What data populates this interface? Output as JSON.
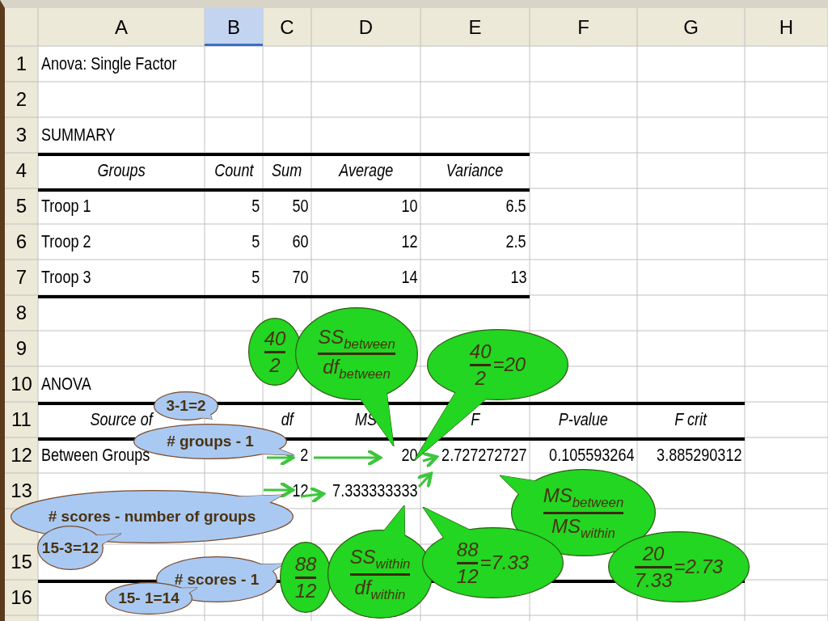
{
  "sheet": {
    "columns": [
      {
        "label": "A",
        "selected": false
      },
      {
        "label": "B",
        "selected": true
      },
      {
        "label": "C",
        "selected": false
      },
      {
        "label": "D",
        "selected": false
      },
      {
        "label": "E",
        "selected": false
      },
      {
        "label": "F",
        "selected": false
      },
      {
        "label": "G",
        "selected": false
      },
      {
        "label": "H",
        "selected": false
      }
    ],
    "rows": [
      {
        "number": "1",
        "kind": "title",
        "rule_above": false,
        "cells": [
          "Anova: Single Factor"
        ]
      },
      {
        "number": "2",
        "kind": "data",
        "rule_above": false,
        "cells": []
      },
      {
        "number": "3",
        "kind": "title",
        "rule_above": false,
        "cells": [
          "SUMMARY"
        ]
      },
      {
        "number": "4",
        "kind": "header",
        "rule_above": true,
        "cells": [
          "Groups",
          "Count",
          "Sum",
          "Average",
          "Variance"
        ]
      },
      {
        "number": "5",
        "kind": "data",
        "rule_above": true,
        "cells": [
          "Troop 1",
          "5",
          "50",
          "10",
          "6.5"
        ]
      },
      {
        "number": "6",
        "kind": "data",
        "rule_above": false,
        "cells": [
          "Troop 2",
          "5",
          "60",
          "12",
          "2.5"
        ]
      },
      {
        "number": "7",
        "kind": "data",
        "rule_above": false,
        "cells": [
          "Troop 3",
          "5",
          "70",
          "14",
          "13"
        ]
      },
      {
        "number": "8",
        "kind": "data",
        "rule_above": true,
        "cells": []
      },
      {
        "number": "9",
        "kind": "data",
        "rule_above": false,
        "cells": []
      },
      {
        "number": "10",
        "kind": "title",
        "rule_above": false,
        "cells": [
          "ANOVA"
        ]
      },
      {
        "number": "11",
        "kind": "header",
        "rule_above": true,
        "cells": [
          "Source of",
          null,
          "df",
          "MS",
          "F",
          "P-value",
          "F crit"
        ]
      },
      {
        "number": "12",
        "kind": "data",
        "rule_above": true,
        "cells": [
          "Between Groups",
          null,
          "2",
          "20",
          "2.727272727",
          "0.105593264",
          "3.885290312"
        ]
      },
      {
        "number": "13",
        "kind": "data",
        "rule_above": false,
        "cells": [
          null,
          null,
          "12",
          "7.333333333"
        ]
      },
      {
        "kind": "data",
        "rule_above": false,
        "cells": []
      },
      {
        "number": "15",
        "kind": "data",
        "rule_above": false,
        "cells": []
      },
      {
        "number": "16",
        "kind": "data",
        "rule_above": true,
        "cells": []
      }
    ]
  },
  "callouts": [
    {
      "kind": "formula",
      "numerator": "40",
      "denominator": "2"
    },
    {
      "kind": "formula",
      "numerator": "SS$_{between}$",
      "denominator": "df$_{between}$"
    },
    {
      "kind": "formula",
      "numerator": "40",
      "denominator": "2",
      "result": "=20"
    },
    {
      "kind": "note",
      "text": "3-1=2"
    },
    {
      "kind": "note",
      "text": "# groups - 1"
    },
    {
      "kind": "note",
      "text": "# scores - number of groups"
    },
    {
      "kind": "formula",
      "numerator": "MS$_{between}$",
      "denominator": "MS$_{within}$"
    },
    {
      "kind": "note",
      "text": "15-3=12"
    },
    {
      "kind": "note",
      "text": "# scores - 1"
    },
    {
      "kind": "note",
      "text": "15- 1=14"
    },
    {
      "kind": "formula",
      "numerator": "88",
      "denominator": "12"
    },
    {
      "kind": "formula",
      "numerator": "SS$_{within}$",
      "denominator": "df$_{within}$"
    },
    {
      "kind": "formula",
      "numerator": "88",
      "denominator": "12",
      "result": "=7.33"
    },
    {
      "kind": "formula",
      "numerator": "20",
      "denominator": "7.33",
      "result": "=2.73"
    }
  ]
}
